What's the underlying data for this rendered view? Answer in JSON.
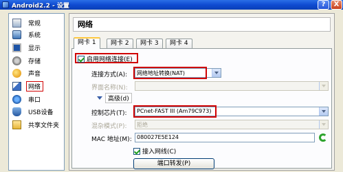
{
  "window": {
    "title": "Android2.2 - 设置",
    "help_label": "?",
    "close_label": "X"
  },
  "sidebar": {
    "items": [
      {
        "label": "常规",
        "icon": "general-icon"
      },
      {
        "label": "系统",
        "icon": "system-icon"
      },
      {
        "label": "显示",
        "icon": "display-icon"
      },
      {
        "label": "存储",
        "icon": "storage-icon"
      },
      {
        "label": "声音",
        "icon": "audio-icon"
      },
      {
        "label": "网络",
        "icon": "network-icon",
        "selected": true
      },
      {
        "label": "串口",
        "icon": "serial-icon"
      },
      {
        "label": "USB设备",
        "icon": "usb-icon"
      },
      {
        "label": "共享文件夹",
        "icon": "shared-folder-icon"
      }
    ]
  },
  "main": {
    "section_title": "网络",
    "tabs": [
      {
        "label": "网卡 1",
        "active": true
      },
      {
        "label": "网卡 2"
      },
      {
        "label": "网卡 3"
      },
      {
        "label": "网卡 4"
      }
    ],
    "enable_adapter": {
      "label": "启用网络连接(E)",
      "checked": true
    },
    "attached_to": {
      "label": "连接方式(A):",
      "value": "网络地址转换(NAT)"
    },
    "interface_name": {
      "label": "界面名称(N):",
      "value": ""
    },
    "advanced": {
      "label": "高级(d)"
    },
    "adapter_type": {
      "label": "控制芯片(T):",
      "value": "PCnet-FAST III (Am79C973)"
    },
    "promiscuous": {
      "label": "混杂模式(P):",
      "value": "拒绝"
    },
    "mac_address": {
      "label": "MAC 地址(M):",
      "value": "080027E5E124"
    },
    "cable_connected": {
      "label": "接入网线(C)",
      "checked": true
    },
    "port_forwarding": {
      "label": "端口转发(P)"
    }
  },
  "colors": {
    "highlight_red": "#d00000",
    "titlebar_blue": "#0f4bd1"
  }
}
